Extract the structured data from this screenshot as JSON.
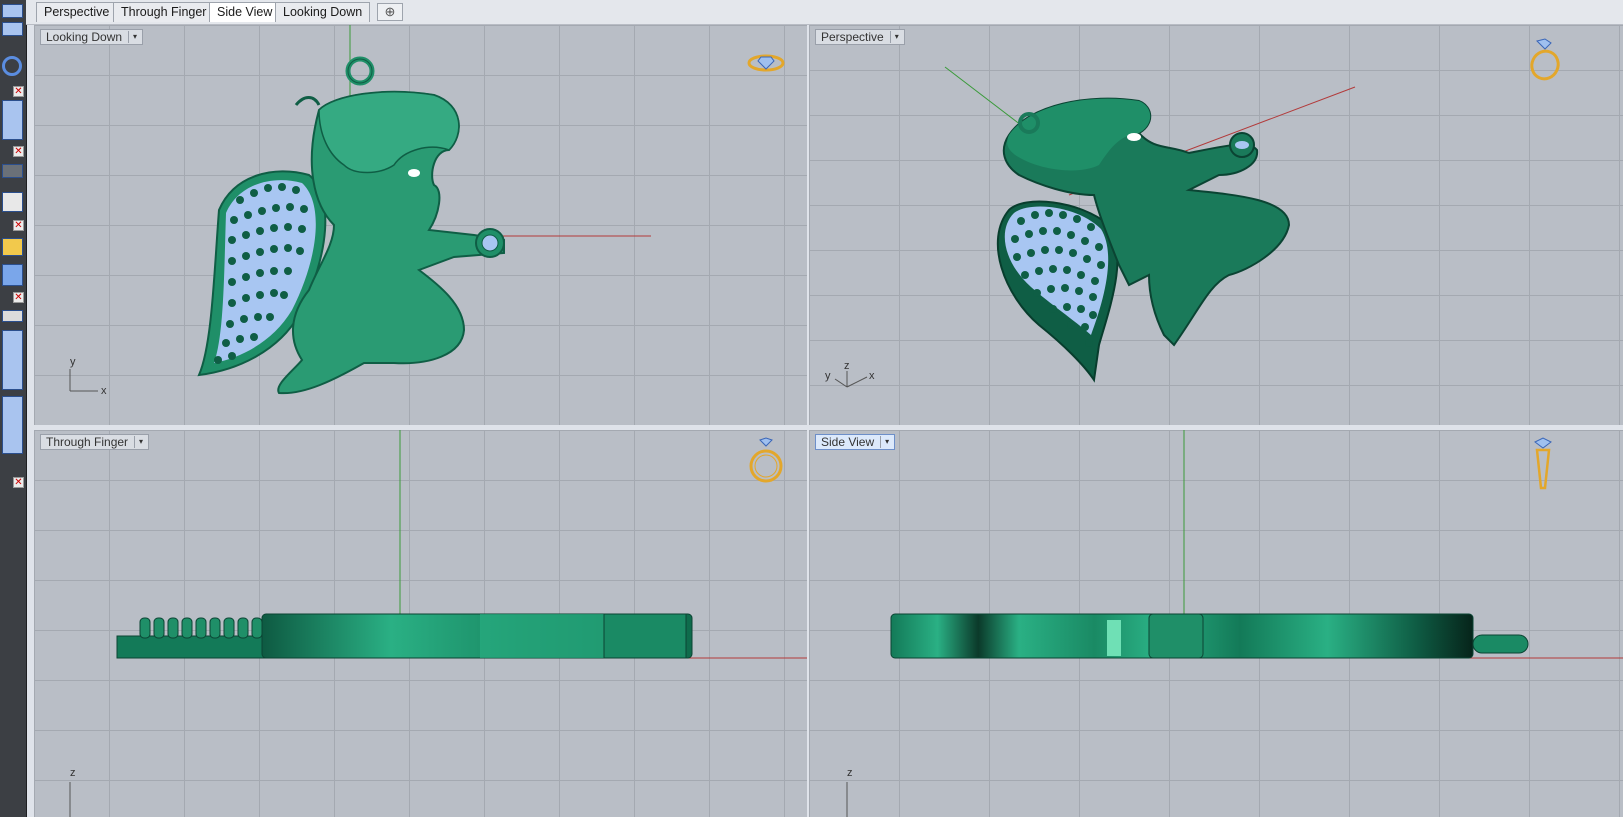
{
  "tabs": [
    {
      "label": "Perspective",
      "active": false
    },
    {
      "label": "Through Finger",
      "active": false
    },
    {
      "label": "Side View",
      "active": true
    },
    {
      "label": "Looking Down",
      "active": false
    }
  ],
  "add_tab_symbol": "⊕",
  "viewports": {
    "top_left": {
      "label": "Looking Down",
      "axis_a": "y",
      "axis_b": "x",
      "view_icon": "ring-top-view-icon"
    },
    "top_right": {
      "label": "Perspective",
      "axis_a": "y",
      "axis_b": "z",
      "axis_c": "x",
      "view_icon": "ring-perspective-icon"
    },
    "bottom_left": {
      "label": "Through Finger",
      "axis_a": "z",
      "view_icon": "ring-front-view-icon"
    },
    "bottom_right": {
      "label": "Side View",
      "axis_a": "z",
      "view_icon": "ring-side-view-icon",
      "active": true
    }
  },
  "dropdown_symbol": "▾",
  "colors": {
    "model_green": "#1f8f68",
    "model_dark": "#0f5e45",
    "gem_blue": "#a8c6f2",
    "view_icon_gold": "#e3a72b",
    "axis_red": "#b23a3a",
    "axis_green": "#3a9a3a"
  }
}
